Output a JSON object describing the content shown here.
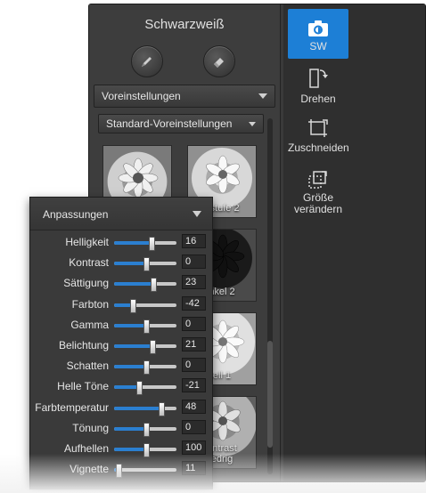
{
  "panel": {
    "title": "Schwarzweiß"
  },
  "tools": [
    {
      "icon": "pen-icon"
    },
    {
      "icon": "eraser-icon"
    }
  ],
  "presets_dropdown": {
    "label": "Voreinstellungen"
  },
  "preset_set_dropdown": {
    "label": "Standard-Voreinstellungen"
  },
  "presets": [
    {
      "label": ""
    },
    {
      "label": "ustufe 2"
    },
    {
      "label": ""
    },
    {
      "label": "nkel 2"
    },
    {
      "label": ""
    },
    {
      "label": "ell 1"
    },
    {
      "label": ""
    },
    {
      "label": "ontrast\nedrig"
    }
  ],
  "sidebar": {
    "items": [
      {
        "label": "SW",
        "icon": "camera-icon",
        "active": true
      },
      {
        "label": "Drehen",
        "icon": "rotate-icon"
      },
      {
        "label": "Zuschneiden",
        "icon": "crop-icon"
      },
      {
        "label": "Größe\nverändern",
        "icon": "resize-icon"
      }
    ]
  },
  "adjustments": {
    "title": "Anpassungen",
    "rows": [
      {
        "label": "Helligkeit",
        "value": "16",
        "position": 0.58
      },
      {
        "label": "Kontrast",
        "value": "0",
        "position": 0.5
      },
      {
        "label": "Sättigung",
        "value": "23",
        "position": 0.61
      },
      {
        "label": "Farbton",
        "value": "-42",
        "position": 0.29
      },
      {
        "label": "Gamma",
        "value": "0",
        "position": 0.5
      },
      {
        "label": "Belichtung",
        "value": "21",
        "position": 0.6
      },
      {
        "label": "Schatten",
        "value": "0",
        "position": 0.5
      },
      {
        "label": "Helle Töne",
        "value": "-21",
        "position": 0.39
      },
      {
        "label": "Farbtemperatur",
        "value": "48",
        "position": 0.74
      },
      {
        "label": "Tönung",
        "value": "0",
        "position": 0.5
      },
      {
        "label": "Aufhellen",
        "value": "100",
        "position": 0.5
      },
      {
        "label": "Vignette",
        "value": "11",
        "position": 0.06
      }
    ]
  },
  "colors": {
    "accent": "#1d7fd6",
    "slider_fill": "#2b7fd0"
  }
}
